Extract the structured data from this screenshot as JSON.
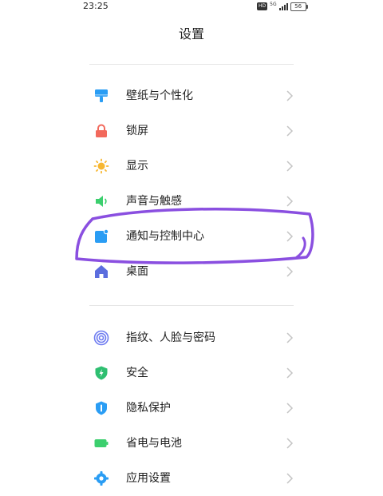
{
  "status_bar": {
    "time": "23:25",
    "hd_badge": "HD",
    "network": "5G",
    "battery": "56"
  },
  "header": {
    "title": "设置"
  },
  "groups": [
    {
      "items": [
        {
          "label": "壁纸与个性化",
          "icon": "wallpaper-icon",
          "color": "#2a9df4"
        },
        {
          "label": "锁屏",
          "icon": "lock-icon",
          "color": "#f2695c"
        },
        {
          "label": "显示",
          "icon": "brightness-icon",
          "color": "#f7b731"
        },
        {
          "label": "声音与触感",
          "icon": "speaker-icon",
          "color": "#3ccf6e"
        },
        {
          "label": "通知与控制中心",
          "icon": "notification-icon",
          "color": "#2a9df4"
        },
        {
          "label": "桌面",
          "icon": "home-icon",
          "color": "#5b6dde"
        }
      ]
    },
    {
      "items": [
        {
          "label": "指纹、人脸与密码",
          "icon": "fingerprint-icon",
          "color": "#6e7cf0"
        },
        {
          "label": "安全",
          "icon": "shield-icon",
          "color": "#2fbf71"
        },
        {
          "label": "隐私保护",
          "icon": "privacy-icon",
          "color": "#2a9df4"
        },
        {
          "label": "省电与电池",
          "icon": "battery-icon",
          "color": "#3ccf6e"
        },
        {
          "label": "应用设置",
          "icon": "gear-icon",
          "color": "#2a9df4"
        }
      ]
    }
  ],
  "annotation": {
    "color": "#8a4fe0"
  }
}
